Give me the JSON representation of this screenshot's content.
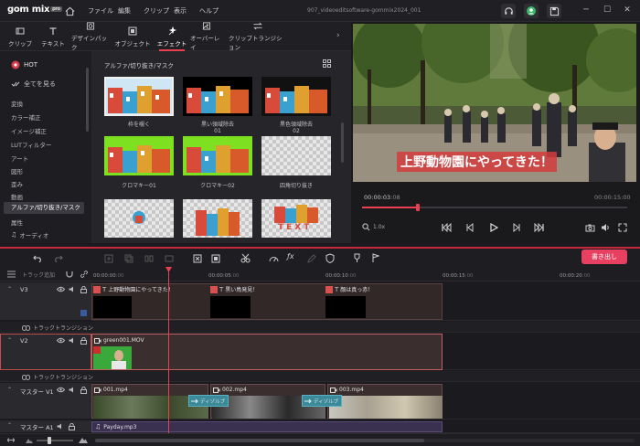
{
  "app": {
    "logo": "gom mix",
    "logo_badge": "pro",
    "project_title": "907_videoeditsoftware-gommix2024_001"
  },
  "menu": [
    "ファイル",
    "編集",
    "クリップ",
    "表示",
    "ヘルプ"
  ],
  "tabs": [
    {
      "label": "クリップ",
      "icon": "clip-icon"
    },
    {
      "label": "テキスト",
      "icon": "text-icon"
    },
    {
      "label": "デザインパック",
      "icon": "design-pack-icon"
    },
    {
      "label": "オブジェクト",
      "icon": "object-icon"
    },
    {
      "label": "エフェクト",
      "icon": "effect-icon",
      "active": true
    },
    {
      "label": "オーバーレイ",
      "icon": "overlay-icon"
    },
    {
      "label": "クリップトランジション",
      "icon": "clip-transition-icon"
    }
  ],
  "categories": {
    "hot": "HOT",
    "show_all": "全てを見る",
    "items": [
      "変換",
      "カラー補正",
      "イメージ補正",
      "LUTフィルター",
      "アート",
      "図形",
      "歪み",
      "動画",
      "アルファ/切り抜き/マスク",
      "属性",
      "オーディオ"
    ],
    "selected": "アルファ/切り抜き/マスク"
  },
  "fx_panel": {
    "title": "アルファ/切り抜き/マスク",
    "items": [
      {
        "label": "枠を覗く",
        "sub": ""
      },
      {
        "label": "黒い領域除去",
        "sub": "01"
      },
      {
        "label": "黒色領域除去",
        "sub": "02"
      },
      {
        "label": "クロマキー01",
        "sub": ""
      },
      {
        "label": "クロマキー02",
        "sub": ""
      },
      {
        "label": "四角切り抜き",
        "sub": ""
      },
      {
        "label": "",
        "sub": ""
      },
      {
        "label": "",
        "sub": ""
      },
      {
        "label": "",
        "sub": ""
      }
    ],
    "text_overlay": "TEXT"
  },
  "preview": {
    "caption": "上野動物園にやってきた！",
    "current_time": "00:00:03",
    "current_frames": "08",
    "total_time": "00:00:15",
    "total_frames": "00",
    "speed": "1.0x",
    "progress": 0.21
  },
  "timeline": {
    "export_label": "書き出し",
    "add_track_label": "トラック追加",
    "ruler": [
      "00:00:00",
      "00:00:05",
      "00:00:10",
      "00:00:15",
      "00:00:20"
    ],
    "ruler_frames": [
      "00",
      "00",
      "00",
      "00",
      "00"
    ],
    "transition_label": "トラックトランジション",
    "tracks": {
      "v3": {
        "name": "V3",
        "clips": [
          "上野動物園にやってきた！",
          "黒い鳥発見！",
          "顔は真っ赤！"
        ]
      },
      "v2": {
        "name": "V2",
        "clip": "green001.MOV"
      },
      "v1": {
        "name": "マスター V1",
        "clips": [
          "001.mp4",
          "002.mp4",
          "003.mp4"
        ],
        "transitions": [
          "ディゾルブ",
          "ディゾルブ"
        ]
      },
      "a1": {
        "name": "マスター A1",
        "clip": "Payday.mp3"
      }
    }
  },
  "colors": {
    "accent": "#e84050",
    "export": "#e84060",
    "green_key": "#5ac23a"
  }
}
